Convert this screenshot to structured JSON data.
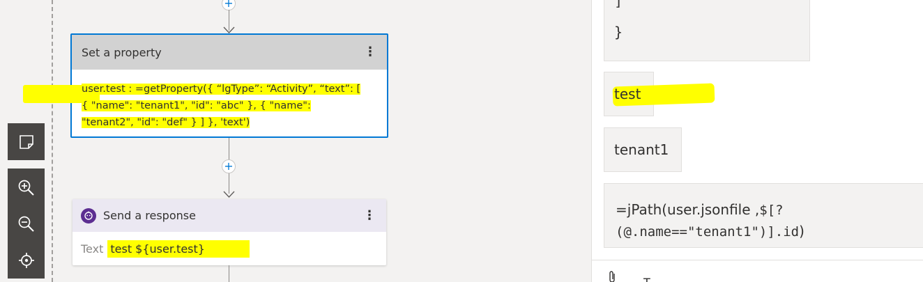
{
  "canvas": {
    "set_property": {
      "title": "Set a property",
      "line1": "user.test : =getProperty({  “lgType”: “Activity”,  “text”: [",
      "line2": "{    \"name\": \"tenant1\",    \"id\": \"abc\"  },  {    \"name\":",
      "line3": "\"tenant2\",    \"id\": \"def\"  } ]  }, 'text')"
    },
    "send_response": {
      "title": "Send a response",
      "field_label": "Text",
      "field_value": "test ${user.test}"
    },
    "add_symbol": "+",
    "more_symbol": "⋮"
  },
  "chat": {
    "json_tail_line1": "]",
    "json_tail_line2": "}",
    "message_test": "test",
    "message_tenant": "tenant1",
    "jpath_prefix": "=jPath(user.jsonfile ,",
    "jpath_part2": "$[?",
    "jpath_line2_mono": "(@.name==\"tenant1\")].id",
    "jpath_close": ")",
    "input_text_cursor": "T"
  },
  "icons": {
    "toolbar": [
      "minimap-icon",
      "zoom-in-icon",
      "zoom-out-icon",
      "fit-to-screen-icon"
    ]
  },
  "colors": {
    "accent": "#0078d4",
    "highlight": "#ffff00",
    "bot": "#5c2e91",
    "toolbar": "#484644"
  }
}
